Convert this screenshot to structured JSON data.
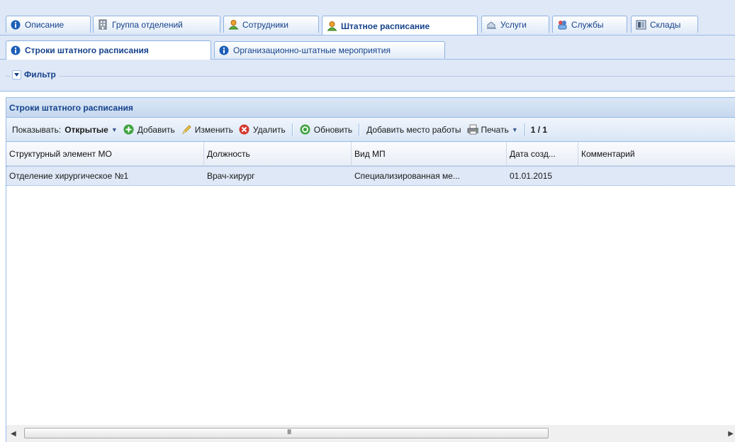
{
  "tabs_main": [
    {
      "label": "Описание",
      "icon": "info-icon"
    },
    {
      "label": "Группа отделений",
      "icon": "building-icon"
    },
    {
      "label": "Сотрудники",
      "icon": "person-icon"
    },
    {
      "label": "Штатное расписание",
      "icon": "person-icon",
      "active": true
    },
    {
      "label": "Услуги",
      "icon": "services-icon"
    },
    {
      "label": "Службы",
      "icon": "staff-service-icon"
    },
    {
      "label": "Склады",
      "icon": "warehouse-icon"
    }
  ],
  "tabs_sub": [
    {
      "label": "Строки штатного расписания",
      "icon": "info-icon",
      "active": true
    },
    {
      "label": "Организационно-штатные мероприятия",
      "icon": "info-icon"
    }
  ],
  "filter": {
    "label": "Фильтр"
  },
  "panel": {
    "title": "Строки штатного расписания"
  },
  "toolbar": {
    "show_label": "Показывать:",
    "show_value": "Открытые",
    "add": "Добавить",
    "edit": "Изменить",
    "delete": "Удалить",
    "refresh": "Обновить",
    "add_workplace": "Добавить место работы",
    "print": "Печать",
    "paging": "1 / 1"
  },
  "grid": {
    "columns": [
      "Структурный элемент МО",
      "Должность",
      "Вид МП",
      "Дата созд...",
      "Комментарий"
    ],
    "rows": [
      [
        "Отделение хирургическое №1",
        "Врач-хирург",
        "Специализированная ме...",
        "01.01.2015",
        ""
      ]
    ]
  },
  "scrollbar": {
    "grip": "III"
  },
  "colors": {
    "accent": "#15428b",
    "border": "#99bbe8",
    "selected_row": "#dfe8f6"
  }
}
